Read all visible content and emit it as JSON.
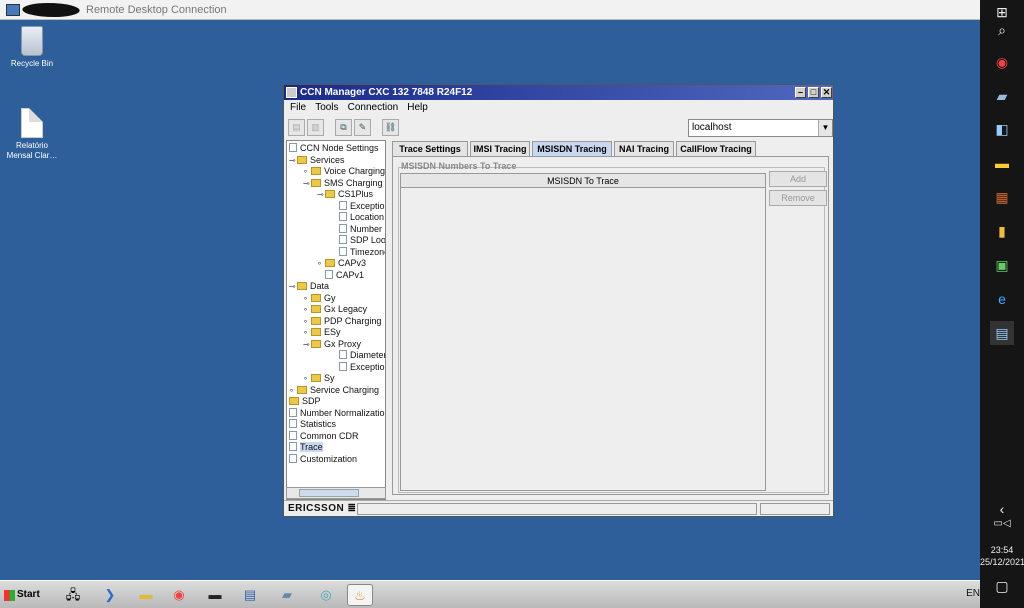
{
  "rdp": {
    "title": "Remote Desktop Connection",
    "min": "–",
    "max": "□",
    "close": "✕"
  },
  "desktop": {
    "icons": [
      {
        "label": "Recycle Bin"
      },
      {
        "label": "Relatório Mensal Clar…"
      }
    ]
  },
  "window": {
    "title": "CCN Manager  CXC 132 7848 R24F12",
    "menu": [
      "File",
      "Tools",
      "Connection",
      "Help"
    ],
    "host": "localhost",
    "tree": [
      {
        "label": "CCN Node Settings",
        "kind": "file",
        "depth": 0
      },
      {
        "label": "Services",
        "kind": "folder",
        "depth": 0,
        "toggle": "open"
      },
      {
        "label": "Voice Charging",
        "kind": "folder",
        "depth": 1,
        "toggle": "closed"
      },
      {
        "label": "SMS Charging",
        "kind": "folder",
        "depth": 1,
        "toggle": "open"
      },
      {
        "label": "CS1Plus",
        "kind": "folder",
        "depth": 2,
        "toggle": "open"
      },
      {
        "label": "Exception",
        "kind": "file",
        "depth": 3
      },
      {
        "label": "Location In",
        "kind": "file",
        "depth": 3
      },
      {
        "label": "Number P",
        "kind": "file",
        "depth": 3
      },
      {
        "label": "SDP Look",
        "kind": "file",
        "depth": 3
      },
      {
        "label": "Timezone",
        "kind": "file",
        "depth": 3
      },
      {
        "label": "CAPv3",
        "kind": "folder",
        "depth": 2,
        "toggle": "closed"
      },
      {
        "label": "CAPv1",
        "kind": "file",
        "depth": 2
      },
      {
        "label": "Data",
        "kind": "folder",
        "depth": 0,
        "toggle": "open"
      },
      {
        "label": "Gy",
        "kind": "folder",
        "depth": 1,
        "toggle": "closed"
      },
      {
        "label": "Gx Legacy",
        "kind": "folder",
        "depth": 1,
        "toggle": "closed"
      },
      {
        "label": "PDP Charging",
        "kind": "folder",
        "depth": 1,
        "toggle": "closed"
      },
      {
        "label": "ESy",
        "kind": "folder",
        "depth": 1,
        "toggle": "closed"
      },
      {
        "label": "Gx Proxy",
        "kind": "folder",
        "depth": 1,
        "toggle": "open"
      },
      {
        "label": "Diameter I",
        "kind": "file",
        "depth": 3
      },
      {
        "label": "Exception",
        "kind": "file",
        "depth": 3
      },
      {
        "label": "Sy",
        "kind": "folder",
        "depth": 1,
        "toggle": "closed"
      },
      {
        "label": "Service Charging",
        "kind": "folder",
        "depth": 0,
        "toggle": "closed"
      },
      {
        "label": "SDP",
        "kind": "folder",
        "depth": 0
      },
      {
        "label": "Number Normalization",
        "kind": "file",
        "depth": 0
      },
      {
        "label": "Statistics",
        "kind": "file",
        "depth": 0
      },
      {
        "label": "Common CDR",
        "kind": "file",
        "depth": 0
      },
      {
        "label": "Trace",
        "kind": "file",
        "depth": 0,
        "selected": true
      },
      {
        "label": "Customization",
        "kind": "file",
        "depth": 0
      }
    ],
    "tabs": [
      "Trace Settings",
      "IMSI Tracing",
      "MSISDN Tracing",
      "NAI Tracing",
      "CallFlow Tracing"
    ],
    "active_tab": 2,
    "group_label": "MSISDN Numbers To Trace",
    "table_header": "MSISDN To Trace",
    "add_label": "Add",
    "remove_label": "Remove",
    "brand": "ERICSSON ≣"
  },
  "taskbar": {
    "start": "Start",
    "lang": "EN"
  },
  "tray": {
    "time": "23:54",
    "date": "25/12/2021"
  }
}
